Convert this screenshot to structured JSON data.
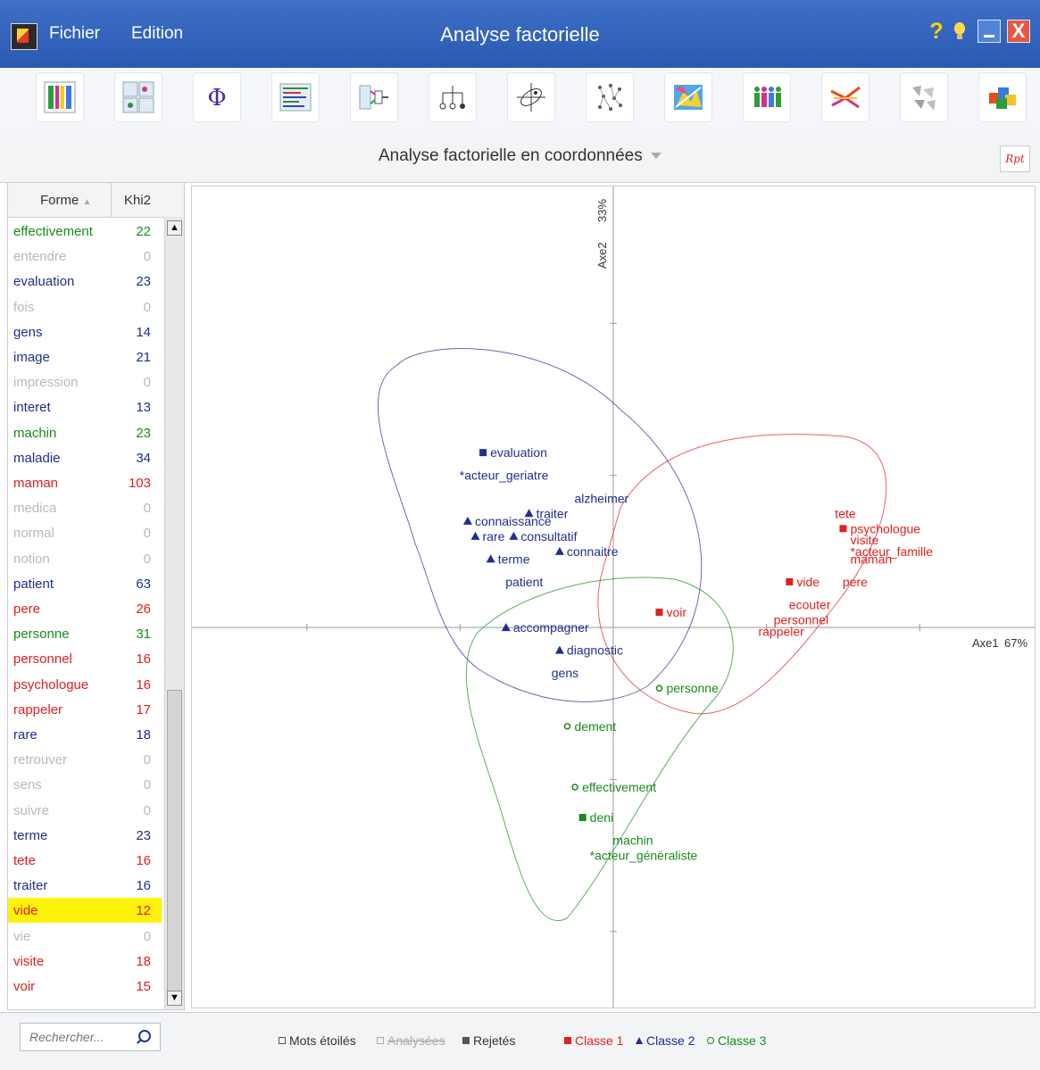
{
  "window": {
    "title": "Analyse factorielle",
    "menu": [
      "Fichier",
      "Edition"
    ],
    "help_glyph": "?",
    "close_glyph": "X"
  },
  "toolbar": {
    "icons": [
      "grid-icon",
      "multi-table-icon",
      "phi-icon",
      "text-concordance-icon",
      "flow-icon",
      "tree-icon",
      "factor-axes-icon",
      "network-icon",
      "map-icon",
      "people-icon",
      "bird-icon",
      "fragments-icon",
      "cubes-icon"
    ]
  },
  "subbar": {
    "title": "Analyse factorielle en coordonnées",
    "rpt": "Rpt"
  },
  "list": {
    "col_forme": "Forme",
    "col_khi2": "Khi2",
    "rows": [
      {
        "word": "effectivement",
        "khi2": "22",
        "color": "#1a8a1a"
      },
      {
        "word": "entendre",
        "khi2": "0",
        "color": "#b8b8b8"
      },
      {
        "word": "evaluation",
        "khi2": "23",
        "color": "#1f2e8f"
      },
      {
        "word": "fois",
        "khi2": "0",
        "color": "#b8b8b8"
      },
      {
        "word": "gens",
        "khi2": "14",
        "color": "#1f2e8f"
      },
      {
        "word": "image",
        "khi2": "21",
        "color": "#1f2e8f"
      },
      {
        "word": "impression",
        "khi2": "0",
        "color": "#b8b8b8"
      },
      {
        "word": "interet",
        "khi2": "13",
        "color": "#1f2e8f"
      },
      {
        "word": "machin",
        "khi2": "23",
        "color": "#1a8a1a"
      },
      {
        "word": "maladie",
        "khi2": "34",
        "color": "#1f2e8f"
      },
      {
        "word": "maman",
        "khi2": "103",
        "color": "#e02020"
      },
      {
        "word": "medica",
        "khi2": "0",
        "color": "#b8b8b8"
      },
      {
        "word": "normal",
        "khi2": "0",
        "color": "#b8b8b8"
      },
      {
        "word": "notion",
        "khi2": "0",
        "color": "#b8b8b8"
      },
      {
        "word": "patient",
        "khi2": "63",
        "color": "#1f2e8f"
      },
      {
        "word": "pere",
        "khi2": "26",
        "color": "#e02020"
      },
      {
        "word": "personne",
        "khi2": "31",
        "color": "#1a8a1a"
      },
      {
        "word": "personnel",
        "khi2": "16",
        "color": "#e02020"
      },
      {
        "word": "psychologue",
        "khi2": "16",
        "color": "#e02020"
      },
      {
        "word": "rappeler",
        "khi2": "17",
        "color": "#e02020"
      },
      {
        "word": "rare",
        "khi2": "18",
        "color": "#1f2e8f"
      },
      {
        "word": "retrouver",
        "khi2": "0",
        "color": "#b8b8b8"
      },
      {
        "word": "sens",
        "khi2": "0",
        "color": "#b8b8b8"
      },
      {
        "word": "suivre",
        "khi2": "0",
        "color": "#b8b8b8"
      },
      {
        "word": "terme",
        "khi2": "23",
        "color": "#1f2e8f"
      },
      {
        "word": "tete",
        "khi2": "16",
        "color": "#e02020"
      },
      {
        "word": "traiter",
        "khi2": "16",
        "color": "#1f2e8f"
      },
      {
        "word": "vide",
        "khi2": "12",
        "color": "#e02020",
        "selected": true
      },
      {
        "word": "vie",
        "khi2": "0",
        "color": "#b8b8b8"
      },
      {
        "word": "visite",
        "khi2": "18",
        "color": "#e02020"
      },
      {
        "word": "voir",
        "khi2": "15",
        "color": "#e02020"
      }
    ]
  },
  "chart_data": {
    "type": "scatter",
    "xlabel": "Axe1",
    "xlabel_pct": "67%",
    "ylabel": "Axe2",
    "ylabel_pct": "33%",
    "xlim": [
      -5.5,
      5.5
    ],
    "ylim": [
      -5,
      5.8
    ],
    "colors": {
      "Classe 1": "#e02020",
      "Classe 2": "#1f2e8f",
      "Classe 3": "#1a8a1a"
    },
    "points": [
      {
        "label": "evaluation",
        "x": -1.7,
        "y": 2.3,
        "cls": "Classe 2",
        "marker": "square"
      },
      {
        "label": "*acteur_geriatre",
        "x": -2.1,
        "y": 2.0,
        "cls": "Classe 2",
        "marker": "none"
      },
      {
        "label": "alzheimer",
        "x": -0.6,
        "y": 1.7,
        "cls": "Classe 2",
        "marker": "none"
      },
      {
        "label": "traiter",
        "x": -1.1,
        "y": 1.5,
        "cls": "Classe 2",
        "marker": "triangle"
      },
      {
        "label": "connaissance",
        "x": -1.9,
        "y": 1.4,
        "cls": "Classe 2",
        "marker": "triangle"
      },
      {
        "label": "consultatif",
        "x": -1.3,
        "y": 1.2,
        "cls": "Classe 2",
        "marker": "triangle"
      },
      {
        "label": "connaitre",
        "x": -0.7,
        "y": 1.0,
        "cls": "Classe 2",
        "marker": "triangle"
      },
      {
        "label": "rare",
        "x": -1.8,
        "y": 1.2,
        "cls": "Classe 2",
        "marker": "triangle"
      },
      {
        "label": "terme",
        "x": -1.6,
        "y": 0.9,
        "cls": "Classe 2",
        "marker": "triangle"
      },
      {
        "label": "patient",
        "x": -1.5,
        "y": 0.6,
        "cls": "Classe 2",
        "marker": "none"
      },
      {
        "label": "accompagner",
        "x": -1.4,
        "y": 0.0,
        "cls": "Classe 2",
        "marker": "triangle"
      },
      {
        "label": "diagnostic",
        "x": -0.7,
        "y": -0.3,
        "cls": "Classe 2",
        "marker": "triangle"
      },
      {
        "label": "gens",
        "x": -0.9,
        "y": -0.6,
        "cls": "Classe 2",
        "marker": "none"
      },
      {
        "label": "tete",
        "x": 2.8,
        "y": 1.5,
        "cls": "Classe 1",
        "marker": "none"
      },
      {
        "label": "psychologue",
        "x": 3.0,
        "y": 1.3,
        "cls": "Classe 1",
        "marker": "square"
      },
      {
        "label": "visite",
        "x": 3.0,
        "y": 1.15,
        "cls": "Classe 1",
        "marker": "none"
      },
      {
        "label": "*acteur_famille",
        "x": 3.0,
        "y": 1.0,
        "cls": "Classe 1",
        "marker": "none"
      },
      {
        "label": "maman",
        "x": 3.0,
        "y": 0.9,
        "cls": "Classe 1",
        "marker": "none"
      },
      {
        "label": "pere",
        "x": 2.9,
        "y": 0.6,
        "cls": "Classe 1",
        "marker": "none"
      },
      {
        "label": "vide",
        "x": 2.3,
        "y": 0.6,
        "cls": "Classe 1",
        "marker": "square"
      },
      {
        "label": "ecouter",
        "x": 2.2,
        "y": 0.3,
        "cls": "Classe 1",
        "marker": "none"
      },
      {
        "label": "personnel",
        "x": 2.0,
        "y": 0.1,
        "cls": "Classe 1",
        "marker": "none"
      },
      {
        "label": "rappeler",
        "x": 1.8,
        "y": -0.05,
        "cls": "Classe 1",
        "marker": "none"
      },
      {
        "label": "voir",
        "x": 0.6,
        "y": 0.2,
        "cls": "Classe 1",
        "marker": "square"
      },
      {
        "label": "personne",
        "x": 0.6,
        "y": -0.8,
        "cls": "Classe 3",
        "marker": "circle"
      },
      {
        "label": "dement",
        "x": -0.6,
        "y": -1.3,
        "cls": "Classe 3",
        "marker": "circle"
      },
      {
        "label": "effectivement",
        "x": -0.5,
        "y": -2.1,
        "cls": "Classe 3",
        "marker": "circle"
      },
      {
        "label": "deni",
        "x": -0.4,
        "y": -2.5,
        "cls": "Classe 3",
        "marker": "square"
      },
      {
        "label": "machin",
        "x": -0.1,
        "y": -2.8,
        "cls": "Classe 3",
        "marker": "none"
      },
      {
        "label": "*acteur_généraliste",
        "x": -0.4,
        "y": -3.0,
        "cls": "Classe 3",
        "marker": "none"
      }
    ]
  },
  "legend": {
    "search_placeholder": "Rechercher...",
    "mots_etoiles": "Mots étoilés",
    "analysees": "Analysées",
    "rejetes": "Rejetés",
    "classe1": "Classe 1",
    "classe2": "Classe 2",
    "classe3": "Classe 3"
  }
}
